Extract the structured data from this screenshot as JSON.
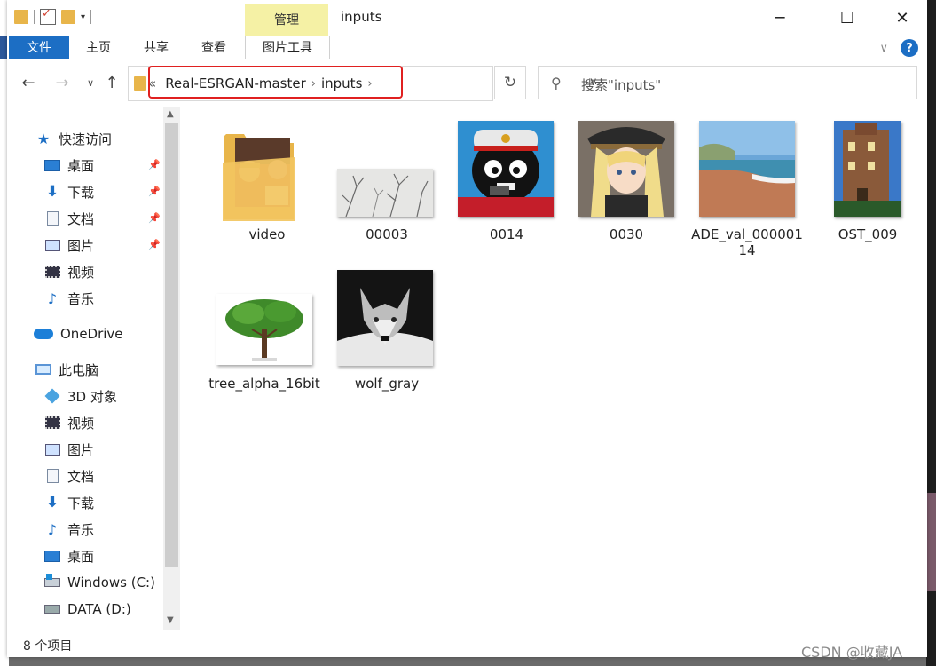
{
  "window": {
    "title": "inputs",
    "context_tab_group": "管理"
  },
  "ribbon": {
    "tabs": [
      {
        "label": "文件"
      },
      {
        "label": "主页"
      },
      {
        "label": "共享"
      },
      {
        "label": "查看"
      },
      {
        "label": "图片工具"
      }
    ]
  },
  "address": {
    "overflow": "«",
    "breadcrumbs": [
      "Real-ESRGAN-master",
      "inputs"
    ]
  },
  "search": {
    "placeholder": "搜索\"inputs\""
  },
  "sidebar": {
    "quick_access": "快速访问",
    "quick_items": [
      {
        "label": "桌面",
        "icon": "desktop-icon"
      },
      {
        "label": "下载",
        "icon": "download-icon"
      },
      {
        "label": "文档",
        "icon": "document-icon"
      },
      {
        "label": "图片",
        "icon": "picture-icon"
      },
      {
        "label": "视频",
        "icon": "video-icon"
      },
      {
        "label": "音乐",
        "icon": "music-icon"
      }
    ],
    "onedrive": "OneDrive",
    "this_pc": "此电脑",
    "pc_items": [
      {
        "label": "3D 对象",
        "icon": "3d-objects-icon"
      },
      {
        "label": "视频",
        "icon": "video-icon"
      },
      {
        "label": "图片",
        "icon": "picture-icon"
      },
      {
        "label": "文档",
        "icon": "document-icon"
      },
      {
        "label": "下载",
        "icon": "download-icon"
      },
      {
        "label": "音乐",
        "icon": "music-icon"
      },
      {
        "label": "桌面",
        "icon": "desktop-icon"
      },
      {
        "label": "Windows (C:)",
        "icon": "windows-drive-icon"
      },
      {
        "label": "DATA (D:)",
        "icon": "drive-icon"
      }
    ]
  },
  "files": [
    {
      "name": "video",
      "type": "folder"
    },
    {
      "name": "00003",
      "type": "image"
    },
    {
      "name": "0014",
      "type": "image"
    },
    {
      "name": "0030",
      "type": "image"
    },
    {
      "name": "ADE_val_00000114",
      "type": "image"
    },
    {
      "name": "OST_009",
      "type": "image"
    },
    {
      "name": "tree_alpha_16bit",
      "type": "image"
    },
    {
      "name": "wolf_gray",
      "type": "image"
    }
  ],
  "status": {
    "item_count": "8 个项目"
  },
  "watermark": "CSDN @收藏JA"
}
